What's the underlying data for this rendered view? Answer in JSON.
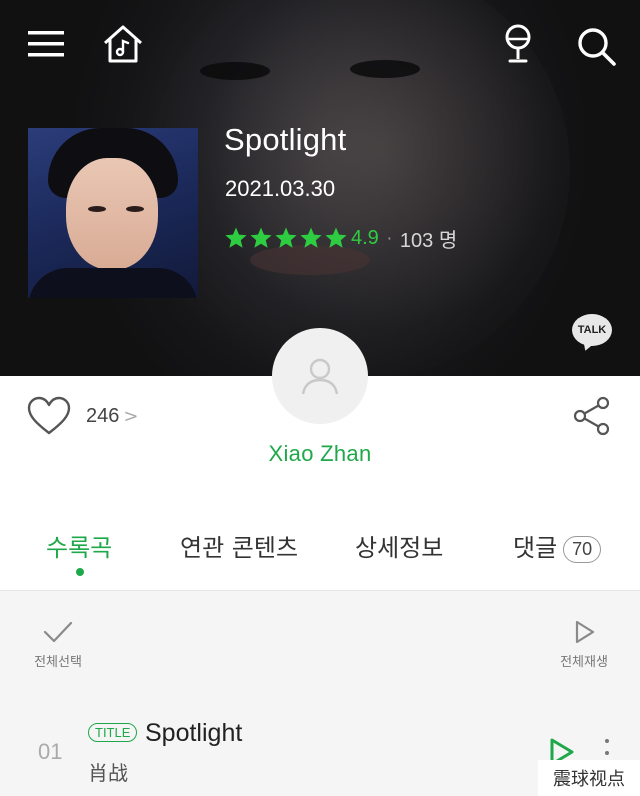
{
  "header": {
    "menu_icon": "hamburger-menu-icon",
    "home_icon": "home-music-icon",
    "mic_icon": "microphone-icon",
    "search_icon": "search-icon"
  },
  "album": {
    "title": "Spotlight",
    "date": "2021.03.30",
    "rating": "4.9",
    "rating_separator": "·",
    "rating_count": "103 명",
    "stars_filled": 5,
    "talk_label": "TALK"
  },
  "social": {
    "like_count": "246",
    "like_chevron": ">"
  },
  "artist": {
    "name": "Xiao Zhan"
  },
  "tabs": [
    {
      "label": "수록곡",
      "active": true
    },
    {
      "label": "연관 콘텐츠",
      "active": false
    },
    {
      "label": "상세정보",
      "active": false
    },
    {
      "label": "댓글",
      "badge": "70",
      "active": false
    }
  ],
  "list_controls": {
    "select_all": "전체선택",
    "play_all": "전체재생"
  },
  "tracks": [
    {
      "number": "01",
      "badge": "TITLE",
      "title": "Spotlight",
      "artist": "肖战"
    }
  ],
  "watermark": "震球视点",
  "colors": {
    "accent_green": "#1fa84a",
    "star_green": "#2ecc40",
    "hero_bg": "#1b1b1e"
  }
}
